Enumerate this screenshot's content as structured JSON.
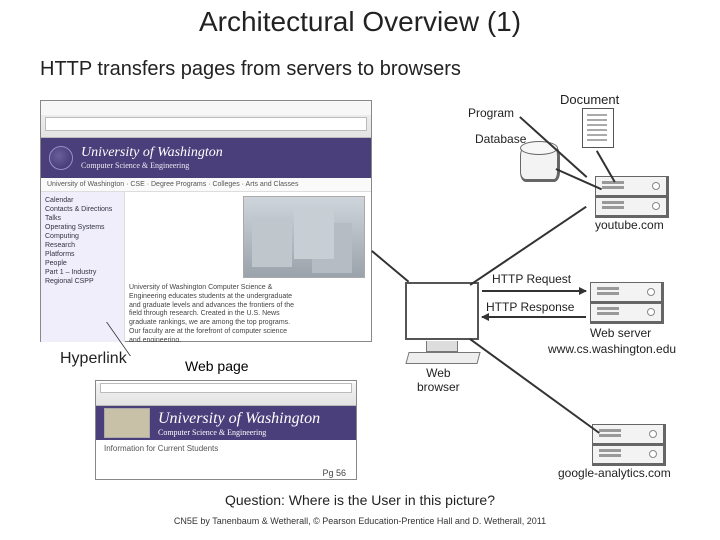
{
  "title": "Architectural Overview (1)",
  "subtitle": "HTTP transfers pages from servers to browsers",
  "question": "Question: Where is the User in this picture?",
  "credit": "CN5E by Tanenbaum & Wetherall, © Pearson Education-Prentice Hall and D. Wetherall, 2011",
  "labels": {
    "document": "Document",
    "program": "Program",
    "database": "Database",
    "youtube": "youtube.com",
    "http_request": "HTTP Request",
    "http_response": "HTTP Response",
    "web_server": "Web server",
    "server_host": "www.cs.washington.edu",
    "web_browser": "Web\nbrowser",
    "google_analytics": "google-analytics.com",
    "hyperlink": "Hyperlink",
    "web_page": "Web page"
  },
  "browser_top": {
    "banner_title": "University of Washington",
    "banner_sub": "Computer Science & Engineering",
    "crumb": "University of Washington · CSE · Degree Programs · Colleges · Arts and Classes",
    "nav": [
      "Calendar",
      "Contacts & Directions",
      "Talks",
      "Operating Systems",
      "Computing",
      "Research",
      "Platforms",
      "People",
      "Part 1 – Industry",
      "Regional CSPP"
    ],
    "para": "University of Washington Computer Science & Engineering educates students at the undergraduate and graduate levels and advances the frontiers of the field through research. Created in the U.S. News graduate rankings, we are among the top programs. Our faculty are at the forefront of computer science and engineering."
  },
  "browser_low": {
    "title": "University of Washington",
    "sub": "Computer Science & Engineering",
    "info": "Information for Current Students",
    "page": "Pg 56"
  }
}
